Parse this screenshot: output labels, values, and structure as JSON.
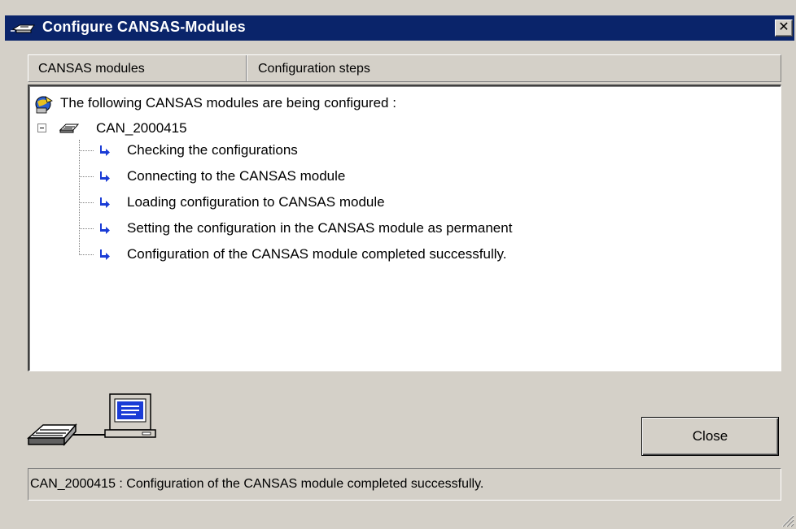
{
  "window": {
    "title": "Configure CANSAS-Modules",
    "close_glyph": "✕"
  },
  "header": {
    "columns": [
      "CANSAS modules",
      "Configuration steps"
    ]
  },
  "tree": {
    "root_label": "The following CANSAS modules are being configured :",
    "module_label": "CAN_2000415",
    "steps": [
      "Checking the configurations",
      "Connecting to the CANSAS module",
      "Loading configuration to CANSAS module",
      "Setting the configuration in the CANSAS module as permanent",
      "Configuration of the CANSAS module completed successfully."
    ]
  },
  "buttons": {
    "close_label": "Close"
  },
  "status": {
    "text": "CAN_2000415 : Configuration of the CANSAS module completed successfully."
  },
  "colors": {
    "titlebar": "#0a246a",
    "face": "#d4d0c8",
    "arrow": "#1a3cd6"
  },
  "icons": {
    "title": "cansas-module-icon",
    "root": "configure-globe-icon",
    "module": "cansas-device-icon",
    "step": "blue-arrow-icon",
    "illustration": "pc-connection-icon"
  }
}
